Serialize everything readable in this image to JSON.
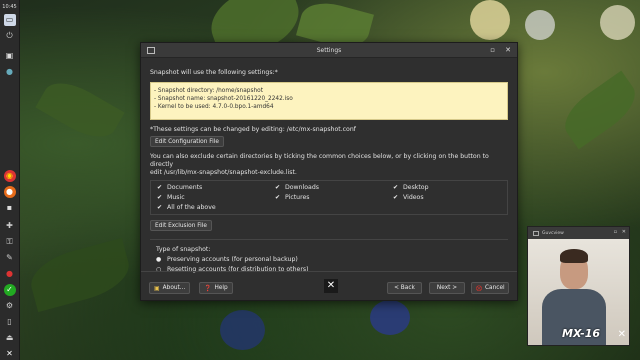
{
  "desktop": {
    "clock": "10:45",
    "brand_label": "MX-16"
  },
  "panel": {
    "icons": [
      "window-icon",
      "power-icon",
      "computer-icon",
      "globe-icon",
      "chrome-icon",
      "firefox-icon",
      "lock-icon",
      "puzzle-icon",
      "key-icon",
      "settings-icon",
      "shield-icon",
      "check-icon",
      "gear-icon",
      "clipboard-icon",
      "eject-icon",
      "mx-logo-icon"
    ]
  },
  "window": {
    "title": "Settings",
    "intro": "Snapshot will use the following settings:*",
    "info_lines": [
      "- Snapshot directory: /home/snapshot",
      "- Snapshot name: snapshot-20161220_2242.iso",
      "- Kernel to be used: 4.7.0-0.bpo.1-amd64"
    ],
    "note": "*These settings can be changed by editing: /etc/mx-snapshot.conf",
    "edit_config_label": "Edit Configuration File",
    "exclude_desc_1": "You can also exclude certain directories by ticking the common choices below, or by clicking on the button to directly",
    "exclude_desc_2": "edit /usr/lib/mx-snapshot/snapshot-exclude.list.",
    "checks": [
      {
        "label": "Documents",
        "checked": true
      },
      {
        "label": "Downloads",
        "checked": true
      },
      {
        "label": "Desktop",
        "checked": true
      },
      {
        "label": "Music",
        "checked": true
      },
      {
        "label": "Pictures",
        "checked": true
      },
      {
        "label": "Videos",
        "checked": true
      },
      {
        "label": "All of the above",
        "checked": true
      }
    ],
    "edit_exclusion_label": "Edit Exclusion File",
    "type_title": "Type of snapshot:",
    "radio_1": "Preserving accounts (for personal backup)",
    "radio_2": "Resetting accounts (for distribution to others)",
    "about_label": "About...",
    "help_label": "Help",
    "back_label": "< Back",
    "next_label": "Next >",
    "cancel_label": "Cancel"
  },
  "webcam": {
    "title": "Guvcview"
  },
  "colors": {
    "info_bg": "#fdf3bf",
    "window_bg": "#2f2f2f",
    "cancel_icon": "#d9322b",
    "help_icon": "#3b6fd1"
  }
}
